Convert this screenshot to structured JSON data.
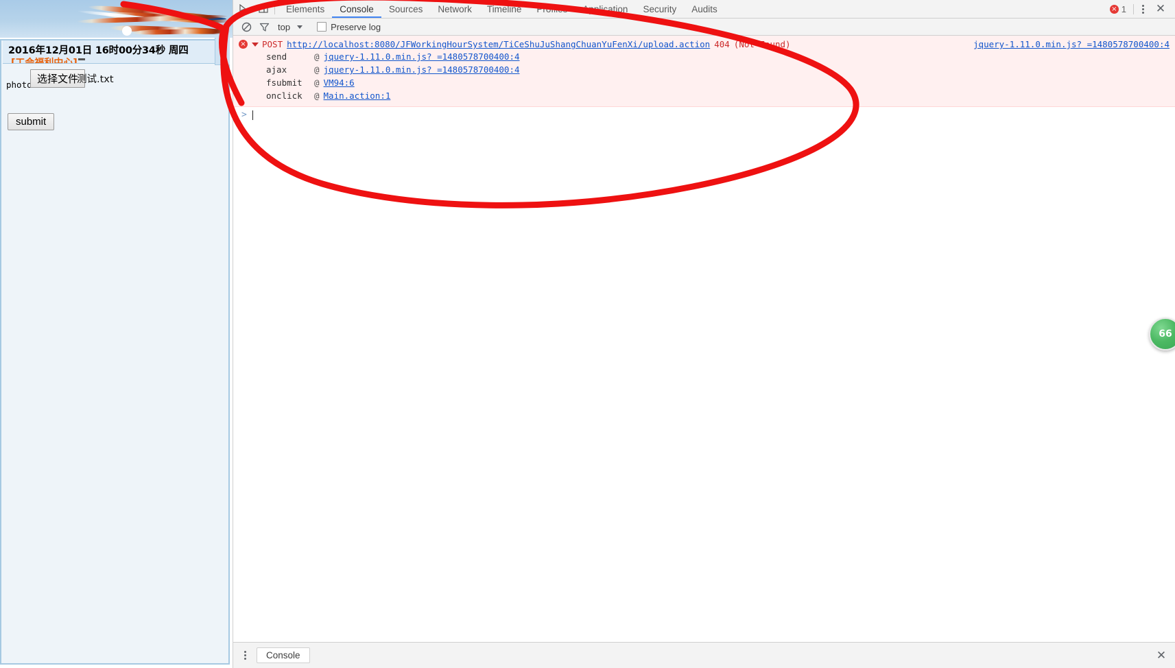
{
  "page": {
    "banner_alt": "macaw-banner-image",
    "clock": "2016年12月01日 16时00分34秒 周四",
    "site_link": "[工会福利中心]",
    "photo_label": "photo:",
    "file_button": "选择文件",
    "file_name": "测试.txt",
    "submit_label": "submit",
    "expander": "»"
  },
  "devtools": {
    "tabs": [
      {
        "label": "Elements",
        "active": false
      },
      {
        "label": "Console",
        "active": true
      },
      {
        "label": "Sources",
        "active": false
      },
      {
        "label": "Network",
        "active": false
      },
      {
        "label": "Timeline",
        "active": false
      },
      {
        "label": "Profiles",
        "active": false
      },
      {
        "label": "Application",
        "active": false
      },
      {
        "label": "Security",
        "active": false
      },
      {
        "label": "Audits",
        "active": false
      }
    ],
    "error_count": "1",
    "toolbar": {
      "clear_icon": "clear-console-icon",
      "filter_icon": "filter-icon",
      "context": "top",
      "preserve_log": "Preserve log",
      "preserve_log_checked": false
    },
    "console": {
      "error": {
        "method": "POST",
        "url": "http://localhost:8080/JFWorkingHourSystem/TiCeShuJuShangChuanYuFenXi/upload.action",
        "status": "404",
        "status_text": "(Not Found)",
        "origin": "jquery-1.11.0.min.js? =1480578700400:4"
      },
      "stack": [
        {
          "fn": "send",
          "at": "@",
          "loc": "jquery-1.11.0.min.js? =1480578700400:4",
          "link": true
        },
        {
          "fn": "ajax",
          "at": "@",
          "loc": "jquery-1.11.0.min.js? =1480578700400:4",
          "link": true
        },
        {
          "fn": "fsubmit",
          "at": "@",
          "loc": "VM94:6",
          "link": true
        },
        {
          "fn": "onclick",
          "at": "@",
          "loc": "Main.action:1",
          "link": true
        }
      ],
      "prompt": ">"
    },
    "drawer": {
      "tab": "Console",
      "close_icon": "close-icon"
    }
  },
  "overlay": {
    "badge_value": "66",
    "annotation_color": "#ee1111"
  }
}
